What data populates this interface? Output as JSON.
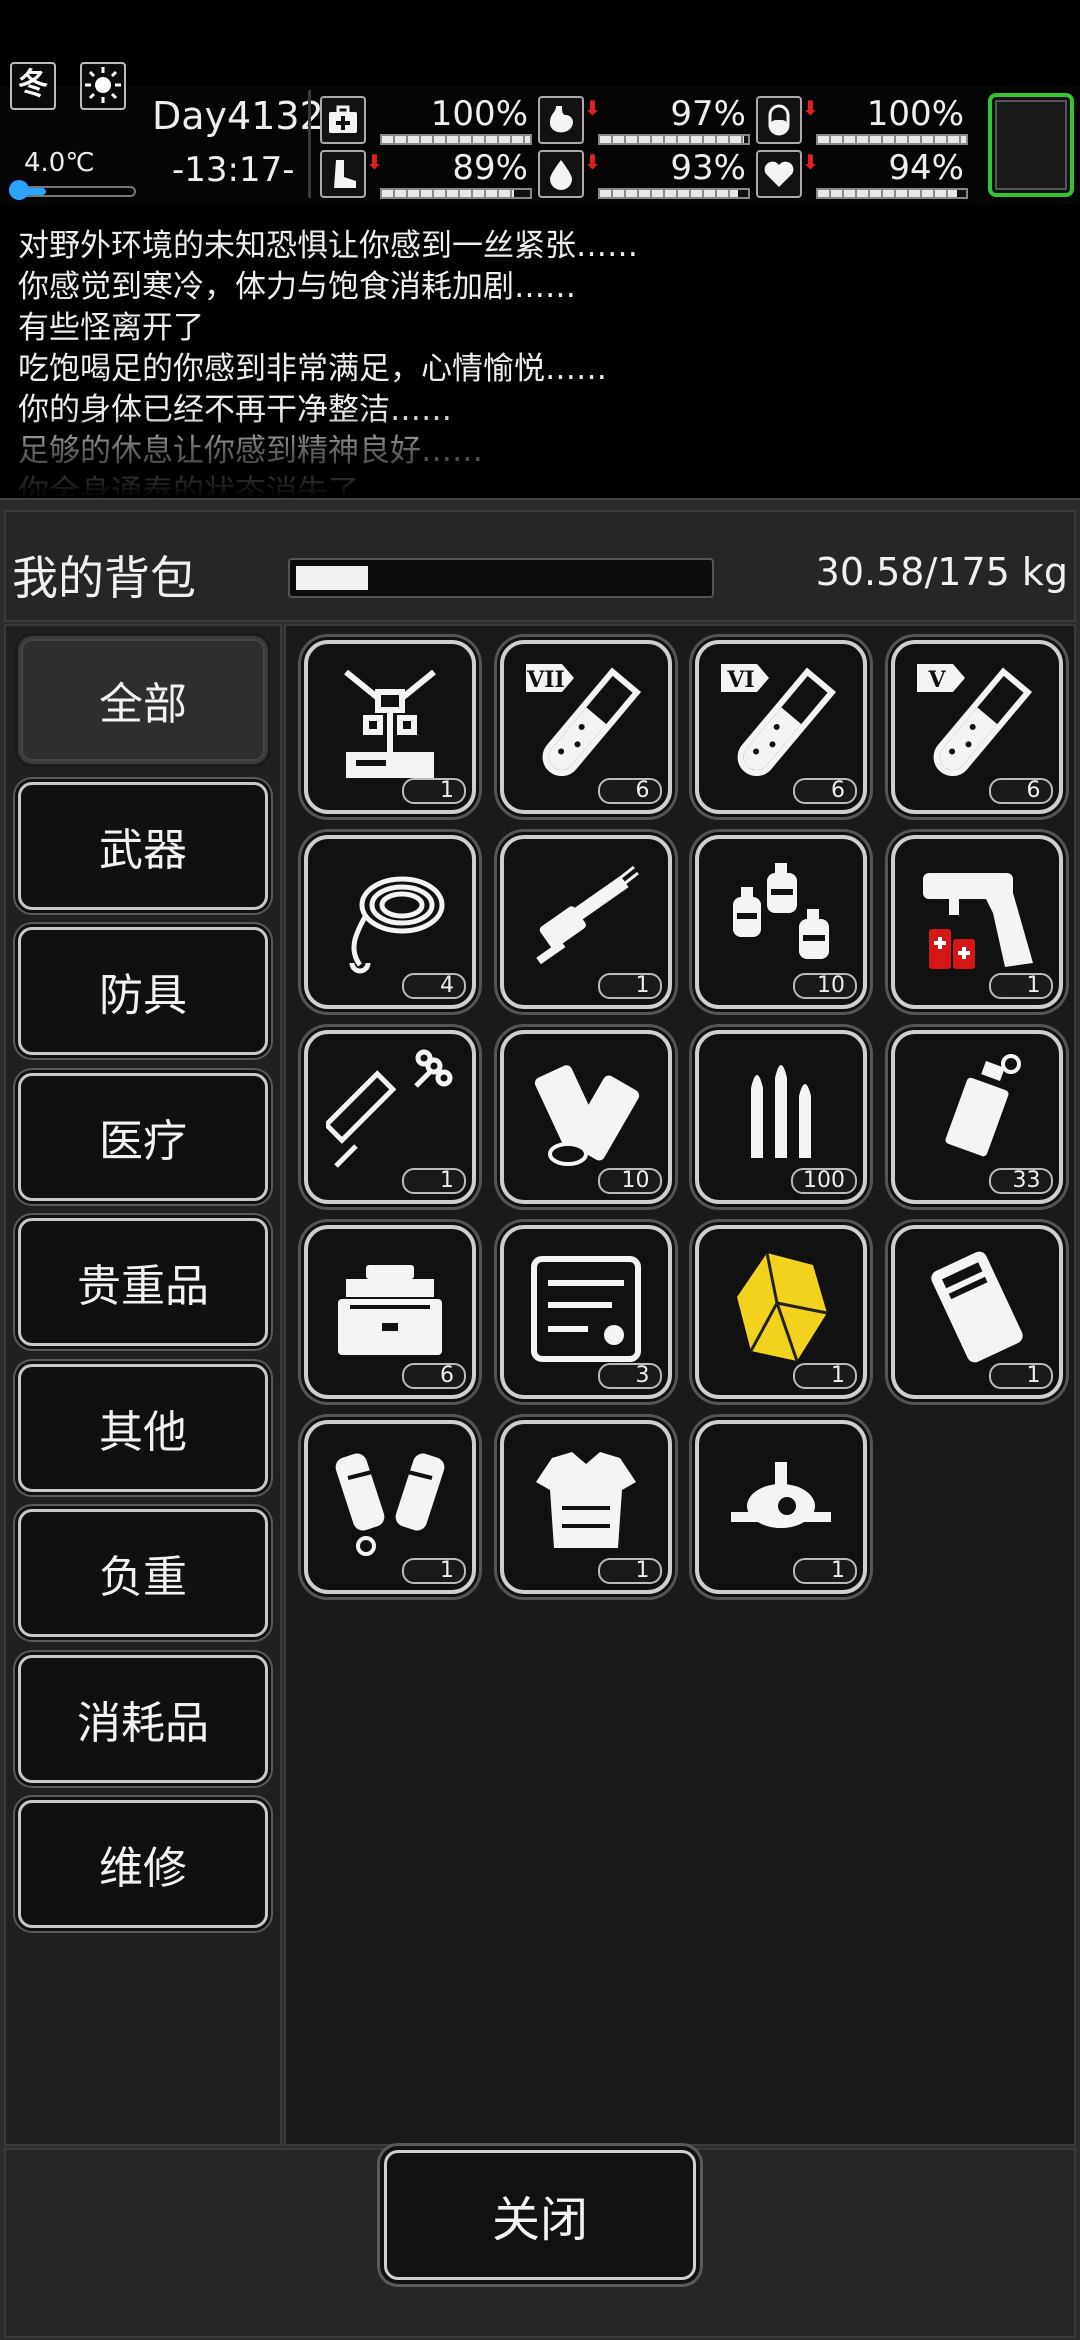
{
  "status": {
    "season": "冬",
    "temperature": "4.0℃",
    "day": "Day4132",
    "time": "-13:17-",
    "stats": [
      {
        "name": "health",
        "icon": "medkit-icon",
        "value": "100%",
        "level": 1.0,
        "down": false
      },
      {
        "name": "hunger",
        "icon": "stomach-icon",
        "value": "97%",
        "level": 0.97,
        "down": true
      },
      {
        "name": "stamina",
        "icon": "pill-icon",
        "value": "100%",
        "level": 1.0,
        "down": true
      },
      {
        "name": "foot",
        "icon": "foot-icon",
        "value": "89%",
        "level": 0.89,
        "down": true
      },
      {
        "name": "thirst",
        "icon": "water-drop-icon",
        "value": "93%",
        "level": 0.93,
        "down": true
      },
      {
        "name": "mood",
        "icon": "heart-icon",
        "value": "94%",
        "level": 0.94,
        "down": true
      }
    ],
    "temperature_level": 0.25
  },
  "log": [
    "对野外环境的未知恐惧让你感到一丝紧张……",
    "你感觉到寒冷，体力与饱食消耗加剧……",
    "有些怪离开了",
    "吃饱喝足的你感到非常满足，心情愉悦……",
    "你的身体已经不再干净整洁……",
    "足够的休息让你感到精神良好……",
    "你全身通泰的状态消失了……"
  ],
  "inventory": {
    "title": "我的背包",
    "weight": "30.58/175 kg",
    "weight_level": 0.175,
    "categories": [
      "全部",
      "武器",
      "防具",
      "医疗",
      "贵重品",
      "其他",
      "负重",
      "消耗品",
      "维修"
    ],
    "active_category": 0,
    "items": [
      {
        "icon": "crafting-device-icon",
        "count": "1"
      },
      {
        "icon": "test-tube-vii-icon",
        "count": "6"
      },
      {
        "icon": "test-tube-vi-icon",
        "count": "6"
      },
      {
        "icon": "test-tube-v-icon",
        "count": "6"
      },
      {
        "icon": "rope-icon",
        "count": "4"
      },
      {
        "icon": "minigun-icon",
        "count": "1"
      },
      {
        "icon": "gas-canisters-icon",
        "count": "10"
      },
      {
        "icon": "flare-gun-icon",
        "count": "1"
      },
      {
        "icon": "syringe-icon",
        "count": "1"
      },
      {
        "icon": "cloth-rolls-icon",
        "count": "10"
      },
      {
        "icon": "bullets-icon",
        "count": "100"
      },
      {
        "icon": "grenade-icon",
        "count": "33"
      },
      {
        "icon": "toolbox-icon",
        "count": "6"
      },
      {
        "icon": "repair-kit-icon",
        "count": "3"
      },
      {
        "icon": "yellow-crystal-icon",
        "count": "1"
      },
      {
        "icon": "battery-pack-icon",
        "count": "1"
      },
      {
        "icon": "arm-guards-icon",
        "count": "1"
      },
      {
        "icon": "body-armor-icon",
        "count": "1"
      },
      {
        "icon": "drone-icon",
        "count": "1"
      }
    ]
  },
  "buttons": {
    "close": "关闭"
  },
  "colors": {
    "status_ok": "#35c235",
    "alert": "#e02020",
    "temp": "#2aa5ff",
    "crystal": "#f2d21c"
  }
}
